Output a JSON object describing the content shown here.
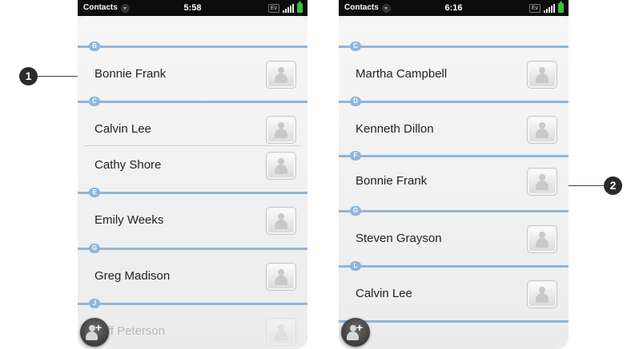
{
  "callouts": [
    "1",
    "2"
  ],
  "screens": [
    {
      "app_menu": "Contacts",
      "time": "5:58",
      "network": "Ev",
      "battery_color": "#36c436",
      "dividers": [
        "B",
        "C",
        "E",
        "G",
        "J"
      ],
      "contacts": [
        "Bonnie Frank",
        "Calvin Lee",
        "Cathy Shore",
        "Emily Weeks",
        "Greg Madison",
        "Jeff Peterson"
      ],
      "add_button_icon": "add-contact-icon"
    },
    {
      "app_menu": "Contacts",
      "time": "6:16",
      "network": "Ev",
      "battery_color": "#36c436",
      "dividers": [
        "C",
        "D",
        "F",
        "G",
        "L"
      ],
      "contacts": [
        "Martha Campbell",
        "Kenneth Dillon",
        "Bonnie Frank",
        "Steven Grayson",
        "Calvin Lee"
      ],
      "add_button_icon": "add-contact-icon"
    }
  ],
  "colors": {
    "divider_accent": "#8fb6da",
    "status_bar": "#0c0c0c"
  }
}
